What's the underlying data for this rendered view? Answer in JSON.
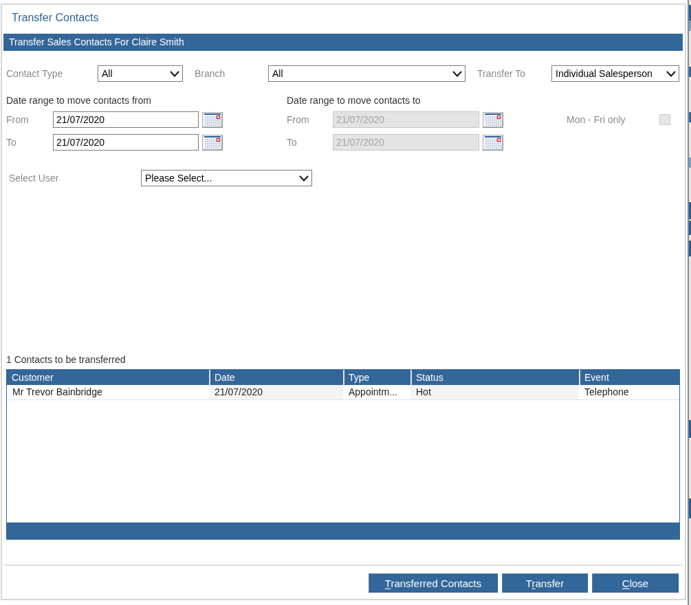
{
  "dialog": {
    "title": "Transfer Contacts"
  },
  "header": {
    "title": "Transfer Sales Contacts For Claire Smith"
  },
  "filters": [
    {
      "label": "Contact Type",
      "value": "All"
    },
    {
      "label": "Branch",
      "value": "All"
    },
    {
      "label": "Transfer To",
      "value": "Individual Salesperson"
    }
  ],
  "date_ranges": [
    {
      "heading": "Date range to move contacts from",
      "fields": [
        {
          "label": "From",
          "value": "21/07/2020",
          "disabled": false
        },
        {
          "label": "To",
          "value": "21/07/2020",
          "disabled": false
        }
      ]
    },
    {
      "heading": "Date range to move contacts to",
      "fields": [
        {
          "label": "From",
          "value": "21/07/2020",
          "disabled": true
        },
        {
          "label": "To",
          "value": "21/07/2020",
          "disabled": true
        }
      ]
    }
  ],
  "weekday_option": {
    "label": "Mon - Fri only",
    "checked": false,
    "disabled": true
  },
  "user_select": {
    "label": "Select User",
    "value": "Please Select..."
  },
  "contacts": {
    "caption": "1 Contacts to be transferred",
    "columns": [
      "Customer",
      "Date",
      "Type",
      "Status",
      "Event"
    ],
    "rows": [
      [
        "Mr Trevor Bainbridge",
        "21/07/2020",
        "Appointm...",
        "Hot",
        "Telephone"
      ]
    ]
  },
  "buttons": [
    {
      "access_key": "T",
      "label_rest": "ransferred Contacts"
    },
    {
      "label_start": "T",
      "access_key": "r",
      "label_rest": "ansfer"
    },
    {
      "access_key": "C",
      "label_rest": "lose"
    }
  ]
}
